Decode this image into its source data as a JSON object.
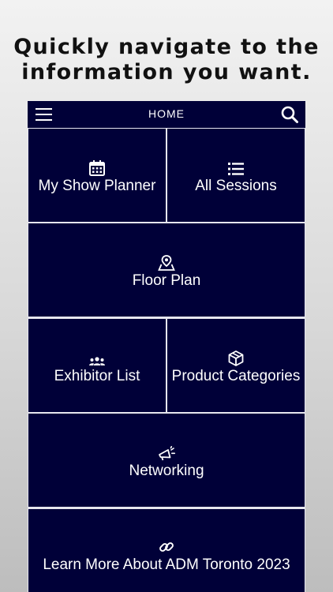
{
  "promo": {
    "line1": "Quickly navigate to the",
    "line2": "information you want."
  },
  "navbar": {
    "title": "HOME",
    "menu_icon": "hamburger-menu-icon",
    "search_icon": "search-icon"
  },
  "tiles": [
    {
      "label": "My Show Planner",
      "icon": "calendar-icon"
    },
    {
      "label": "All Sessions",
      "icon": "list-icon"
    },
    {
      "label": "Floor Plan",
      "icon": "map-pin-icon"
    },
    {
      "label": "Exhibitor List",
      "icon": "users-icon"
    },
    {
      "label": "Product Categories",
      "icon": "box-icon"
    },
    {
      "label": "Networking",
      "icon": "megaphone-icon"
    },
    {
      "label": "Learn More About ADM Toronto 2023",
      "icon": "link-icon"
    }
  ],
  "colors": {
    "tile_background": "#000038",
    "tile_text": "#ffffff",
    "grid_lines": "#e6e6ee"
  }
}
